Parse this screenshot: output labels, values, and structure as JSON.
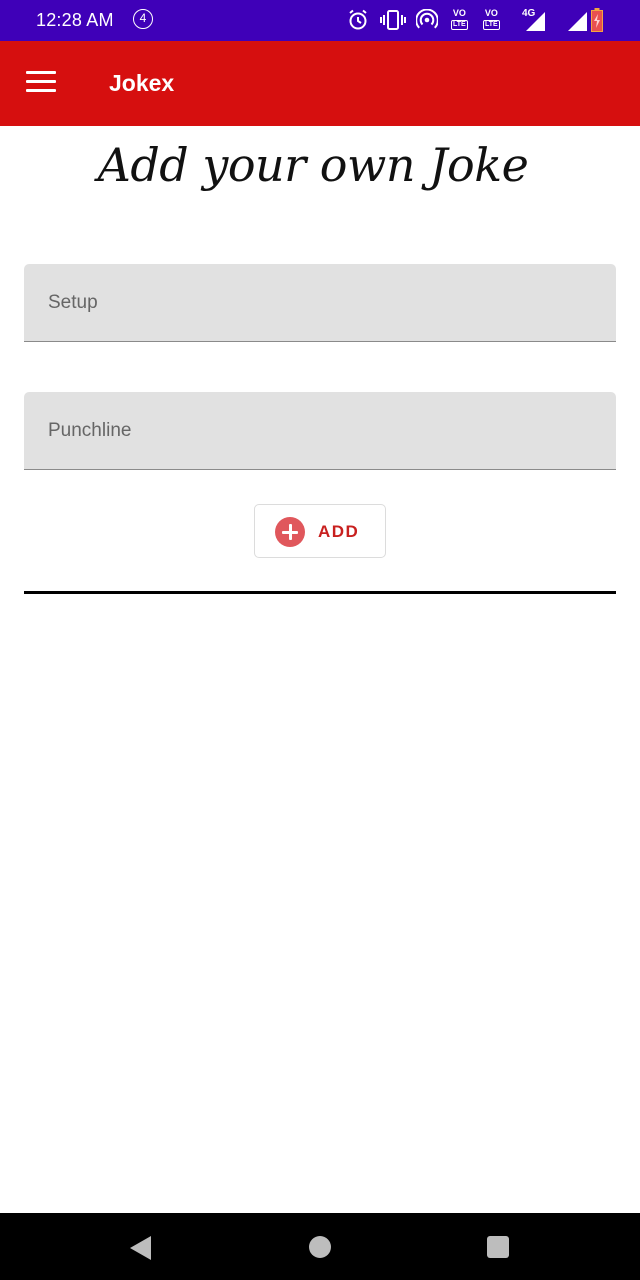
{
  "status_bar": {
    "time": "12:28 AM",
    "notification_count": "4",
    "volte1_label": "VO",
    "volte1_sub": "LTE",
    "volte2_label": "VO",
    "volte2_sub": "LTE",
    "network_type": "4G",
    "icons": [
      "alarm-icon",
      "vibrate-icon",
      "hotspot-icon",
      "volte-icon",
      "volte-icon",
      "signal-icon",
      "signal-icon",
      "battery-charging-icon"
    ]
  },
  "app_bar": {
    "title": "Jokex",
    "menu_icon": "hamburger-menu-icon",
    "background": "#d60f0f"
  },
  "main": {
    "heading": "Add your own Joke",
    "setup_field": {
      "placeholder": "Setup",
      "value": ""
    },
    "punchline_field": {
      "placeholder": "Punchline",
      "value": ""
    },
    "add_button": {
      "label": "ADD",
      "icon": "plus-circle-icon",
      "accent": "#c8201f"
    }
  },
  "nav_bar": {
    "icons": [
      "back-icon",
      "home-icon",
      "recents-icon"
    ]
  }
}
